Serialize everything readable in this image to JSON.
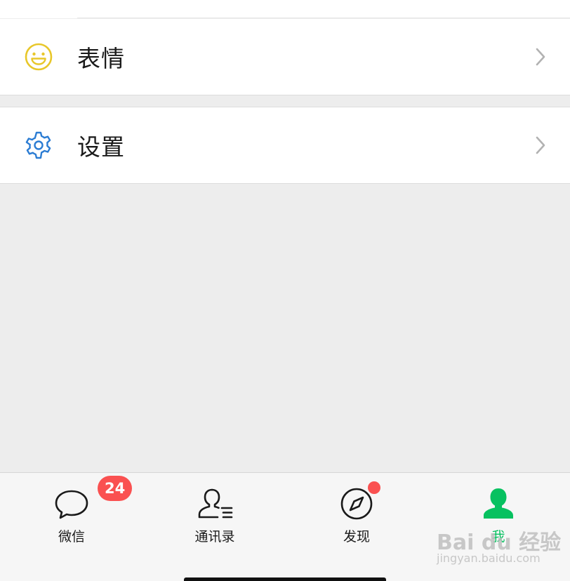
{
  "menu": {
    "sticker": {
      "label": "表情",
      "icon": "smiley-icon",
      "color": "#e8c72a"
    },
    "settings": {
      "label": "设置",
      "icon": "gear-icon",
      "color": "#2b7cd3"
    }
  },
  "tabbar": {
    "active_color": "#07c160",
    "badge_color": "#fa5151",
    "tabs": [
      {
        "label": "微信",
        "icon": "chat-bubble-icon",
        "badge": "24"
      },
      {
        "label": "通讯录",
        "icon": "contacts-icon"
      },
      {
        "label": "发现",
        "icon": "compass-icon",
        "dot": true
      },
      {
        "label": "我",
        "icon": "person-icon",
        "active": true
      }
    ]
  },
  "watermark": {
    "main": "Bai du 经验",
    "sub": "jingyan.baidu.com"
  }
}
